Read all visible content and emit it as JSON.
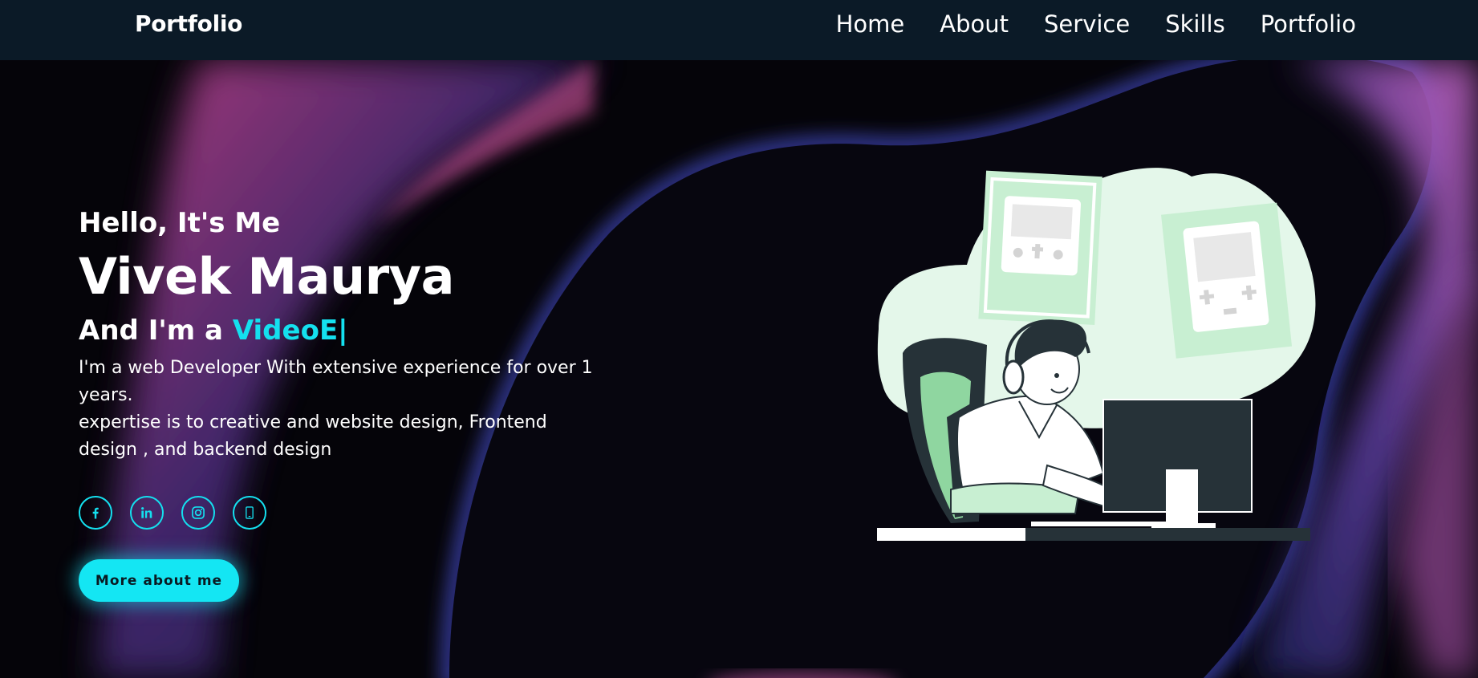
{
  "nav": {
    "logo": "Portfolio",
    "links": [
      "Home",
      "About",
      "Service",
      "Skills",
      "Portfolio"
    ]
  },
  "hero": {
    "greeting": "Hello, It's Me",
    "name": "Vivek Maurya",
    "role_prefix": "And I'm a ",
    "role_typed": "VideoE",
    "role_cursor": "|",
    "description_line1": "I'm a web Developer With extensive experience for over 1 years.",
    "description_line2": "expertise is to creative and website design, Frontend design , and backend design"
  },
  "socials": [
    {
      "icon": "facebook-icon"
    },
    {
      "icon": "linkedin-icon"
    },
    {
      "icon": "instagram-icon"
    },
    {
      "icon": "mobile-icon"
    }
  ],
  "cta": {
    "label": "More about me"
  },
  "colors": {
    "accent": "#14e0ef",
    "navbar": "#0b1a27",
    "background": "#050409"
  }
}
